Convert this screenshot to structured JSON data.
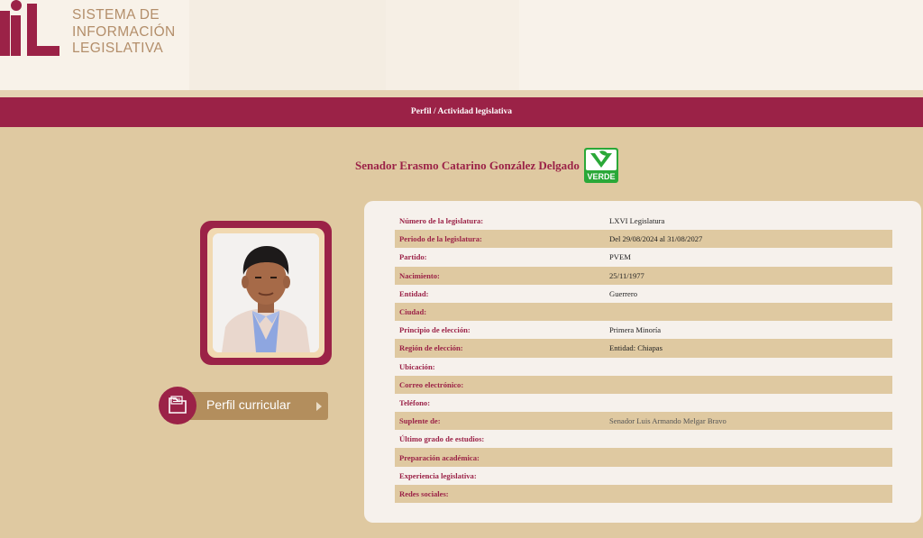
{
  "header": {
    "logo_text": [
      "SISTEMA DE",
      "INFORMACIÓN",
      "LEGISLATIVA"
    ]
  },
  "nav": {
    "breadcrumb": "Perfil / Actividad legislativa"
  },
  "profile": {
    "name": "Senador Erasmo Catarino González Delgado",
    "party_logo_text": "VERDE",
    "cv_button": "Perfil curricular"
  },
  "details": [
    {
      "key": "Número de la legislatura:",
      "value": "LXVI Legislatura"
    },
    {
      "key": "Periodo de la legislatura:",
      "value": "Del 29/08/2024 al 31/08/2027"
    },
    {
      "key": "Partido:",
      "value": "PVEM"
    },
    {
      "key": "Nacimiento:",
      "value": "25/11/1977"
    },
    {
      "key": "Entidad:",
      "value": "Guerrero"
    },
    {
      "key": "Ciudad:",
      "value": ""
    },
    {
      "key": "Principio de elección:",
      "value": "Primera Minoría"
    },
    {
      "key": "Región de elección:",
      "value": "Entidad: Chiapas"
    },
    {
      "key": "Ubicación:",
      "value": ""
    },
    {
      "key": "Correo electrónico:",
      "value": ""
    },
    {
      "key": "Teléfono:",
      "value": ""
    },
    {
      "key": "Suplente de:",
      "value": "Senador Luis Armando Melgar Bravo"
    },
    {
      "key": "Último grado de estudios:",
      "value": ""
    },
    {
      "key": "Preparación académica:",
      "value": ""
    },
    {
      "key": "Experiencia legislativa:",
      "value": ""
    },
    {
      "key": "Redes sociales:",
      "value": ""
    }
  ],
  "colors": {
    "brand": "#9b2247",
    "gold": "#b38e5d",
    "background": "#dfc9a1",
    "party_green": "#2aa838"
  }
}
